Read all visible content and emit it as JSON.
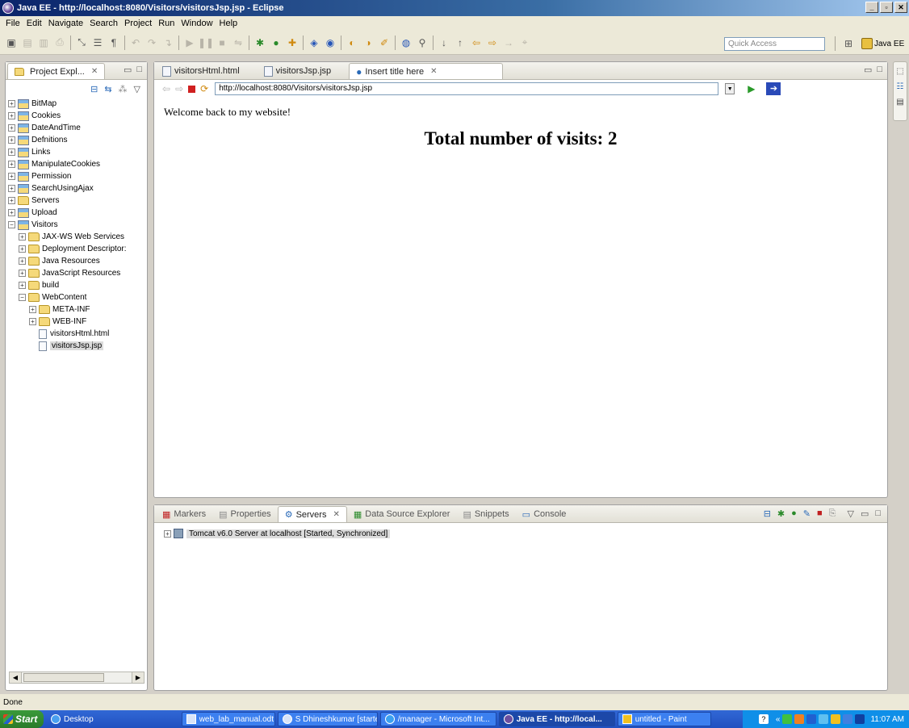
{
  "window": {
    "title": "Java EE - http://localhost:8080/Visitors/visitorsJsp.jsp - Eclipse"
  },
  "menu": [
    "File",
    "Edit",
    "Navigate",
    "Search",
    "Project",
    "Run",
    "Window",
    "Help"
  ],
  "toolbar": {
    "quick_access_placeholder": "Quick Access",
    "perspective": "Java EE"
  },
  "explorer": {
    "title": "Project Expl...",
    "tree": [
      {
        "label": "BitMap",
        "depth": 0,
        "type": "project"
      },
      {
        "label": "Cookies",
        "depth": 0,
        "type": "project"
      },
      {
        "label": "DateAndTime",
        "depth": 0,
        "type": "project"
      },
      {
        "label": "Defnitions",
        "depth": 0,
        "type": "project"
      },
      {
        "label": "Links",
        "depth": 0,
        "type": "project"
      },
      {
        "label": "ManipulateCookies",
        "depth": 0,
        "type": "project"
      },
      {
        "label": "Permission",
        "depth": 0,
        "type": "project"
      },
      {
        "label": "SearchUsingAjax",
        "depth": 0,
        "type": "project"
      },
      {
        "label": "Servers",
        "depth": 0,
        "type": "folder"
      },
      {
        "label": "Upload",
        "depth": 0,
        "type": "project"
      },
      {
        "label": "Visitors",
        "depth": 0,
        "type": "project"
      },
      {
        "label": "JAX-WS Web Services",
        "depth": 1,
        "type": "folder"
      },
      {
        "label": "Deployment Descriptor:",
        "depth": 1,
        "type": "folder"
      },
      {
        "label": "Java Resources",
        "depth": 1,
        "type": "folder"
      },
      {
        "label": "JavaScript Resources",
        "depth": 1,
        "type": "folder"
      },
      {
        "label": "build",
        "depth": 1,
        "type": "folder"
      },
      {
        "label": "WebContent",
        "depth": 1,
        "type": "folder"
      },
      {
        "label": "META-INF",
        "depth": 2,
        "type": "folder"
      },
      {
        "label": "WEB-INF",
        "depth": 2,
        "type": "folder"
      },
      {
        "label": "visitorsHtml.html",
        "depth": 2,
        "type": "file"
      },
      {
        "label": "visitorsJsp.jsp",
        "depth": 2,
        "type": "file",
        "selected": true
      }
    ]
  },
  "editor": {
    "tabs": [
      {
        "label": "visitorsHtml.html",
        "active": false
      },
      {
        "label": "visitorsJsp.jsp",
        "active": false
      },
      {
        "label": "Insert title here",
        "active": true
      }
    ],
    "url": "http://localhost:8080/Visitors/visitorsJsp.jsp",
    "welcome": "Welcome back to my website!",
    "visits_heading": "Total number of visits: 2"
  },
  "bottom": {
    "tabs": [
      "Markers",
      "Properties",
      "Servers",
      "Data Source Explorer",
      "Snippets",
      "Console"
    ],
    "active_tab": "Servers",
    "server_row": "Tomcat v6.0 Server at localhost  [Started, Synchronized]"
  },
  "status": "Done",
  "taskbar": {
    "start": "Start",
    "desktop": "Desktop",
    "tasks": [
      "web_lab_manual.odt - O...",
      "S Dhineshkumar [started...",
      "/manager - Microsoft Int...",
      "Java EE - http://local...",
      "untitled - Paint"
    ],
    "clock": "11:07 AM"
  },
  "colors": {
    "tray_blue": "#0f8fe8",
    "title_blue": "#0a246a"
  }
}
